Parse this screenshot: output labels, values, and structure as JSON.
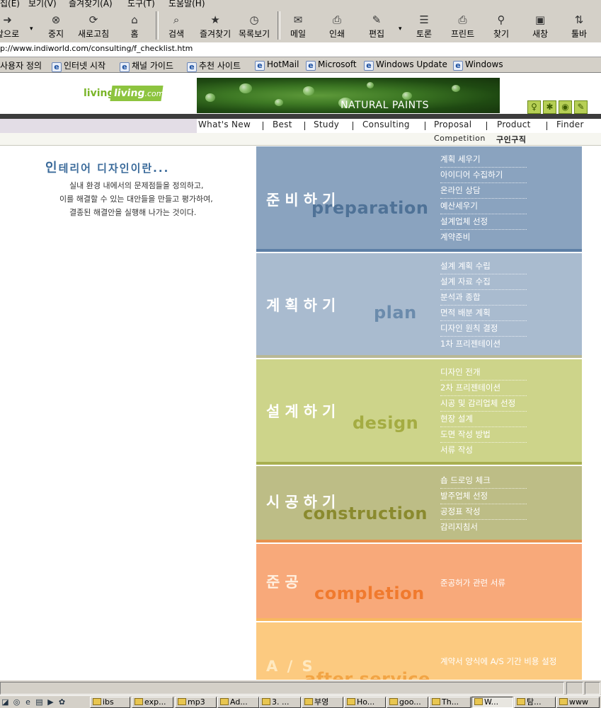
{
  "menubar": {
    "items": [
      "집(E)",
      "보기(V)",
      "즐겨찾기(A)",
      "도구(T)",
      "도움말(H)"
    ]
  },
  "toolbar": {
    "buttons": [
      {
        "label": "앞으로",
        "icon": "forward-arrow-icon"
      },
      {
        "label": "중지",
        "icon": "stop-icon"
      },
      {
        "label": "새로고침",
        "icon": "refresh-icon"
      },
      {
        "label": "홈",
        "icon": "home-icon"
      },
      {
        "label": "검색",
        "icon": "search-icon"
      },
      {
        "label": "즐겨찾기",
        "icon": "favorites-icon"
      },
      {
        "label": "목록보기",
        "icon": "history-icon"
      },
      {
        "label": "메일",
        "icon": "mail-icon"
      },
      {
        "label": "인쇄",
        "icon": "print-icon"
      },
      {
        "label": "편집",
        "icon": "edit-icon"
      },
      {
        "label": "토론",
        "icon": "discuss-icon"
      },
      {
        "label": "프린트",
        "icon": "printer-icon"
      },
      {
        "label": "찾기",
        "icon": "find-icon"
      },
      {
        "label": "새창",
        "icon": "new-window-icon"
      },
      {
        "label": "툴바",
        "icon": "toolbar-icon"
      }
    ]
  },
  "address": {
    "url": "p://www.indiworld.com/consulting/f_checklist.htm"
  },
  "links": {
    "items": [
      "사용자 정의",
      "인터넷 시작",
      "채널 가이드",
      "추천 사이트",
      "HotMail",
      "Microsoft",
      "Windows Update",
      "Windows"
    ]
  },
  "site": {
    "logo_text1": "living",
    "logo_text2": "living",
    "logo_suffix": ".com",
    "banner_title": "NATURAL PAINTS",
    "nav": [
      "What's New",
      "Best",
      "Study",
      "Consulting",
      "Proposal",
      "Product",
      "Finder"
    ],
    "subnav": [
      "Competition",
      "구인구직"
    ]
  },
  "intro": {
    "title_big": "인",
    "title_rest": "테리어 디자인이란...",
    "lines": [
      "실내 환경 내에서의 문제점들을 정의하고,",
      "이를 해결할 수 있는 대안들을 만들고 평가하여,",
      "결종된 해결안을 실행해 나가는 것이다."
    ]
  },
  "sections": [
    {
      "kr": "준비하기",
      "en": "preparation",
      "bg": "#8aa3bf",
      "items": [
        "계획 세우기",
        "아이디어 수집하기",
        "온라인 상담",
        "예산세우기",
        "설계업체 선정",
        "계약준비"
      ]
    },
    {
      "kr": "계획하기",
      "en": "plan",
      "bg": "#a9bbcf",
      "items": [
        "설계 계획 수립",
        "설계 자료 수집",
        "분석과 종합",
        "면적 배분 계획",
        "디자인 원칙 결정",
        "1차 프리젠테이션"
      ]
    },
    {
      "kr": "설계하기",
      "en": "design",
      "bg": "#cdd48a",
      "items": [
        "디자인 전개",
        "2차 프리젠테이션",
        "시공 및 감리업체 선정",
        "현장 설계",
        "도면 작성 방법",
        "서류 작성"
      ]
    },
    {
      "kr": "시공하기",
      "en": "construction",
      "bg": "#bdbd86",
      "items": [
        "숍 드로잉 체크",
        "발주업체 선정",
        "공정표 작성",
        "감리지침서"
      ]
    },
    {
      "kr": "준공",
      "en": "completion",
      "bg": "#f8a97a",
      "items": [
        "준공허가 관련 서류"
      ]
    },
    {
      "kr": "A / S",
      "en": "after service",
      "bg": "#fcca80",
      "items": [
        "계약서 양식에 A/S 기간 비용 설정"
      ]
    }
  ],
  "taskbar": {
    "tasks": [
      "ibs",
      "exp...",
      "mp3",
      "Ad...",
      "3. ...",
      "부영",
      "Ho...",
      "goo...",
      "Th...",
      "W...",
      "탐...",
      "www"
    ]
  }
}
